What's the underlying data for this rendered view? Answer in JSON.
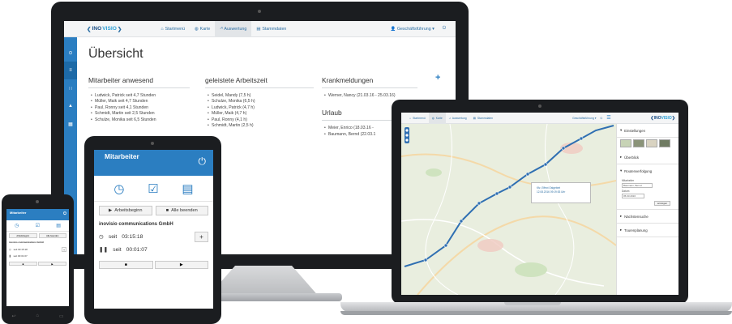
{
  "desktop": {
    "logo": {
      "name_part1": "INO",
      "name_part2": "VISIO",
      "tagline": "communications"
    },
    "nav": [
      {
        "label": "Startmenü",
        "icon": "home-icon"
      },
      {
        "label": "Karte",
        "icon": "globe-icon"
      },
      {
        "label": "Auswertung",
        "icon": "chart-icon"
      },
      {
        "label": "Stammdaten",
        "icon": "book-icon"
      }
    ],
    "user_menu": "Geschäftsführung",
    "page_title": "Übersicht",
    "sections": {
      "present": {
        "heading": "Mitarbeiter anwesend",
        "items": [
          "Ludwick, Patrick seit 4,7 Stunden",
          "Müller, Maik seit 4,7 Stunden",
          "Paul, Ronny seit 4,1 Stunden",
          "Schmidt, Martin seit 2,5 Stunden",
          "Schulze, Monika seit 6,5 Stunden"
        ]
      },
      "worked": {
        "heading": "geleistete Arbeitszeit",
        "items": [
          "Seidel, Mandy (7,5 h)",
          "Schulze, Monika (6,5 h)",
          "Ludwick, Patrick (4,7 h)",
          "Müller, Maik (4,7 h)",
          "Paul, Ronny (4,1 h)",
          "Schmidt, Martin (2,5 h)"
        ]
      },
      "sick": {
        "heading": "Krankmeldungen",
        "items": [
          "Werner, Nancy (21.03.16 - 25.03.16)"
        ]
      },
      "vacation": {
        "heading": "Urlaub",
        "items": [
          "Meier, Enrico (18.03.16 -",
          "Baumann, Bernd (22.03.1"
        ]
      }
    }
  },
  "laptop": {
    "nav": [
      "Startmenü",
      "Karte",
      "Auswertung",
      "Stammdaten"
    ],
    "user_menu": "Geschäftsführung",
    "popup": {
      "line1": "Kfz, Effect Ostgebiet",
      "line2": "12.08.2016 09:19:53 Uhr"
    },
    "panel": {
      "einstellungen": "Einstellungen",
      "ueberblick": "Überblick",
      "routen": "Routenverfolgung",
      "mitarbeiter_label": "Mitarbeiter",
      "mitarbeiter_value": "Baumann, Bernd",
      "datum_label": "Datum",
      "datum_value": "05.03.2016",
      "anzeigen": "anzeigen",
      "naechste": "Nächstensuche",
      "touren": "Tourenplanung"
    }
  },
  "tablet": {
    "title": "Mitarbeiter",
    "btn_start": "Arbeitsbeginn",
    "btn_end": "Alle beenden",
    "company": "inovisio communications GmbH",
    "row1_label": "seit",
    "row1_time": "03:15:18",
    "row2_label": "seit",
    "row2_time": "00:01:07"
  },
  "phone": {
    "title": "Mitarbeiter",
    "btn_start": "Arbeitsbeginn",
    "btn_end": "Alle beenden",
    "company": "inovisio communications GmbH",
    "row1": "seit 03:15:18",
    "row2": "seit 00:01:07"
  },
  "colors": {
    "accent": "#2b7ec1",
    "route": "#2f6fb2",
    "brand_dark": "#1b4f86"
  }
}
